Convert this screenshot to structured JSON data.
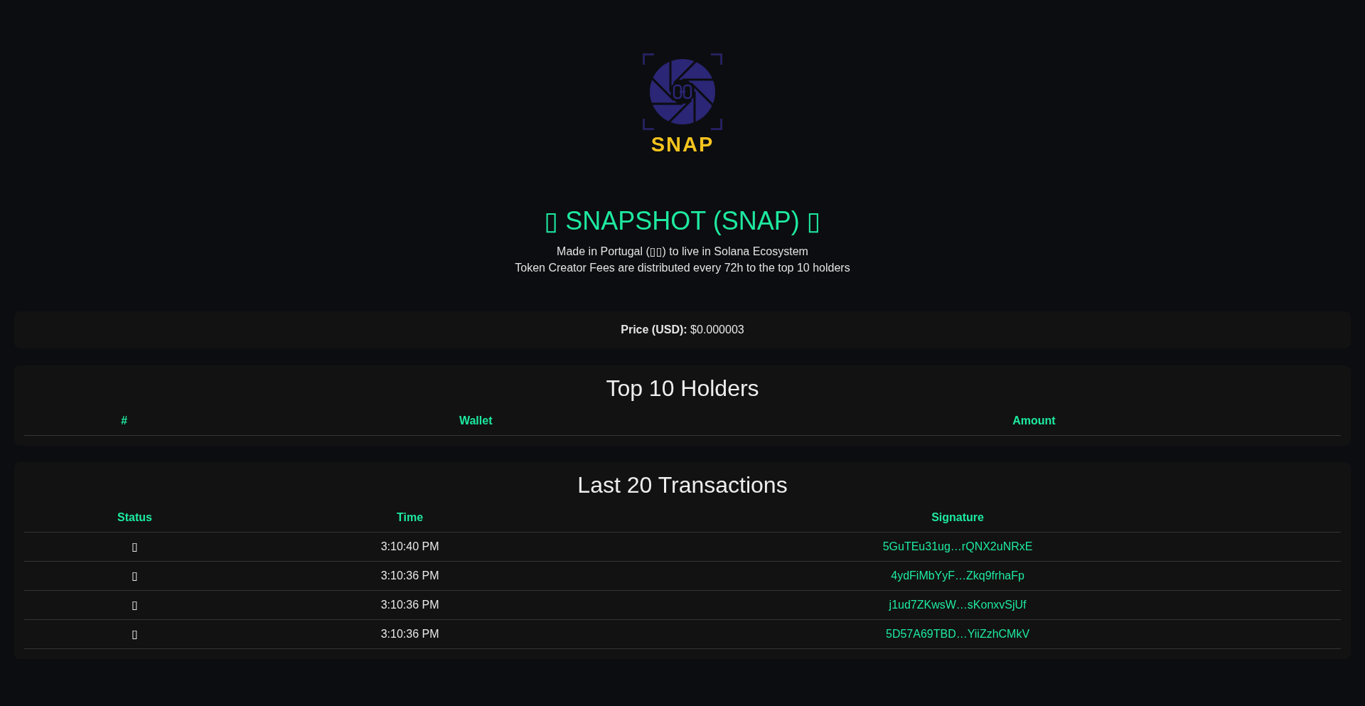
{
  "logo": {
    "wordmark": "SNAP"
  },
  "header": {
    "title": "▯ SNAPSHOT (SNAP) ▯",
    "taglines": [
      "Made in Portugal (▯▯) to live in Solana Ecosystem",
      "Token Creator Fees are distributed every 72h to the top 10 holders"
    ]
  },
  "price": {
    "label": "Price (USD):",
    "value": "$0.000003"
  },
  "holders": {
    "title": "Top 10 Holders",
    "columns": [
      "#",
      "Wallet",
      "Amount"
    ]
  },
  "transactions": {
    "title": "Last 20 Transactions",
    "columns": [
      "Status",
      "Time",
      "Signature"
    ],
    "rows": [
      {
        "status": "▯",
        "time": "3:10:40 PM",
        "signature": "5GuTEu31ug…rQNX2uNRxE"
      },
      {
        "status": "▯",
        "time": "3:10:36 PM",
        "signature": "4ydFiMbYyF…Zkq9frhaFp"
      },
      {
        "status": "▯",
        "time": "3:10:36 PM",
        "signature": "j1ud7ZKwsW…sKonxvSjUf"
      },
      {
        "status": "▯",
        "time": "3:10:36 PM",
        "signature": "5D57A69TBD…YiiZzhCMkV"
      }
    ]
  }
}
